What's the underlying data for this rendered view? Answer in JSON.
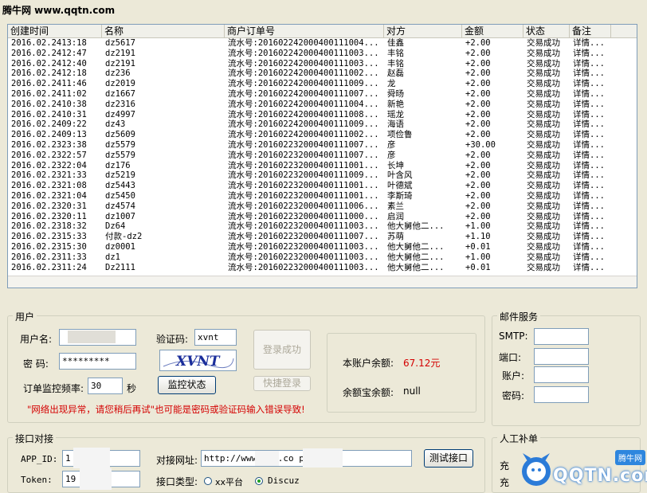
{
  "watermark": "腾牛网 www.qqtn.com",
  "table": {
    "columns": [
      "创建时间",
      "名称",
      "商户订单号",
      "对方",
      "金额",
      "状态",
      "备注"
    ],
    "rows": [
      [
        "2016.02.2413:18",
        "dz5617",
        "流水号:201602242000400111004...",
        "佳鑫",
        "+2.00",
        "交易成功",
        "详情..."
      ],
      [
        "2016.02.2412:47",
        "dz2191",
        "流水号:201602242000400111003...",
        "丰铭",
        "+2.00",
        "交易成功",
        "详情..."
      ],
      [
        "2016.02.2412:40",
        "dz2191",
        "流水号:201602242000400111003...",
        "丰铭",
        "+2.00",
        "交易成功",
        "详情..."
      ],
      [
        "2016.02.2412:18",
        "dz236",
        "流水号:201602242000400111002...",
        "赵磊",
        "+2.00",
        "交易成功",
        "详情..."
      ],
      [
        "2016.02.2411:46",
        "dz2019",
        "流水号:201602242000400111009...",
        "龙",
        "+2.00",
        "交易成功",
        "详情..."
      ],
      [
        "2016.02.2411:02",
        "dz1667",
        "流水号:201602242000400111007...",
        "舜旸",
        "+2.00",
        "交易成功",
        "详情..."
      ],
      [
        "2016.02.2410:38",
        "dz2316",
        "流水号:201602242000400111004...",
        "新艳",
        "+2.00",
        "交易成功",
        "详情..."
      ],
      [
        "2016.02.2410:31",
        "dz4997",
        "流水号:201602242000400111008...",
        "瑶龙",
        "+2.00",
        "交易成功",
        "详情..."
      ],
      [
        "2016.02.2409:22",
        "dz43",
        "流水号:201602242000400111009...",
        "海语",
        "+2.00",
        "交易成功",
        "详情..."
      ],
      [
        "2016.02.2409:13",
        "dz5609",
        "流水号:201602242000400111002...",
        "项俭鲁",
        "+2.00",
        "交易成功",
        "详情..."
      ],
      [
        "2016.02.2323:38",
        "dz5579",
        "流水号:201602232000400111007...",
        "彦",
        "+30.00",
        "交易成功",
        "详情..."
      ],
      [
        "2016.02.2322:57",
        "dz5579",
        "流水号:201602232000400111007...",
        "彦",
        "+2.00",
        "交易成功",
        "详情..."
      ],
      [
        "2016.02.2322:04",
        "dz176",
        "流水号:201602232000400111001...",
        "长坤",
        "+2.00",
        "交易成功",
        "详情..."
      ],
      [
        "2016.02.2321:33",
        "dz5219",
        "流水号:201602232000400111009...",
        "叶含风",
        "+2.00",
        "交易成功",
        "详情..."
      ],
      [
        "2016.02.2321:08",
        "dz5443",
        "流水号:201602232000400111001...",
        "叶德斌",
        "+2.00",
        "交易成功",
        "详情..."
      ],
      [
        "2016.02.2321:04",
        "dz5450",
        "流水号:201602232000400111001...",
        "李斯琦",
        "+2.00",
        "交易成功",
        "详情..."
      ],
      [
        "2016.02.2320:31",
        "dz4574",
        "流水号:201602232000400111006...",
        "素兰",
        "+2.00",
        "交易成功",
        "详情..."
      ],
      [
        "2016.02.2320:11",
        "dz1007",
        "流水号:201602232000400111000...",
        "启润",
        "+2.00",
        "交易成功",
        "详情..."
      ],
      [
        "2016.02.2318:32",
        "Dz64",
        "流水号:201602232000400111003...",
        "他大舅他二...",
        "+1.00",
        "交易成功",
        "详情..."
      ],
      [
        "2016.02.2315:33",
        "付款-dz2",
        "流水号:201602232000400111007...",
        "苏萌",
        "+1.10",
        "交易成功",
        "详情..."
      ],
      [
        "2016.02.2315:30",
        "dz0001",
        "流水号:201602232000400111003...",
        "他大舅他二...",
        "+0.01",
        "交易成功",
        "详情..."
      ],
      [
        "2016.02.2311:33",
        "dz1",
        "流水号:201602232000400111003...",
        "他大舅他二...",
        "+1.00",
        "交易成功",
        "详情..."
      ],
      [
        "2016.02.2311:24",
        "Dz2111",
        "流水号:201602232000400111003...",
        "他大舅他二...",
        "+0.01",
        "交易成功",
        "详情..."
      ]
    ]
  },
  "user": {
    "title": "用户",
    "username_label": "用户名:",
    "password_label": "密  码:",
    "password_value": "*********",
    "captcha_label": "验证码:",
    "captcha_input": "xvnt",
    "captcha_image_text": "XVNT",
    "login_button": "登录成功",
    "freq_label": "订单监控频率:",
    "freq_value": "30",
    "freq_unit": "秒",
    "monitor_button": "监控状态",
    "quick_login_button": "快捷登录",
    "balance_label": "本账户余额:",
    "balance_value": "67.12元",
    "yuebao_label": "余额宝余额:",
    "yuebao_value": "null",
    "error_message": "\"网络出现异常，请您稍后再试\"也可能是密码或验证码输入错误导致!"
  },
  "mail": {
    "title": "邮件服务",
    "smtp_label": "SMTP:",
    "port_label": "端口:",
    "account_label": "账户:",
    "password_label": "密码:"
  },
  "app": {
    "title": "接口对接",
    "appid_label": "APP_ID:",
    "appid_value": "1",
    "token_label": "Token:",
    "token_value": "19",
    "url_label": "对接网址:",
    "url_value": "http://www.        ig.co          p        p",
    "test_button": "测试接口",
    "type_label": "接口类型:",
    "option_xx": "xx平台",
    "option_discuz": "Discuz"
  },
  "manual": {
    "title": "人工补单",
    "label1": "充",
    "label2": "充"
  },
  "logo": {
    "text": "QQTN.com",
    "tag": "腾牛网"
  }
}
